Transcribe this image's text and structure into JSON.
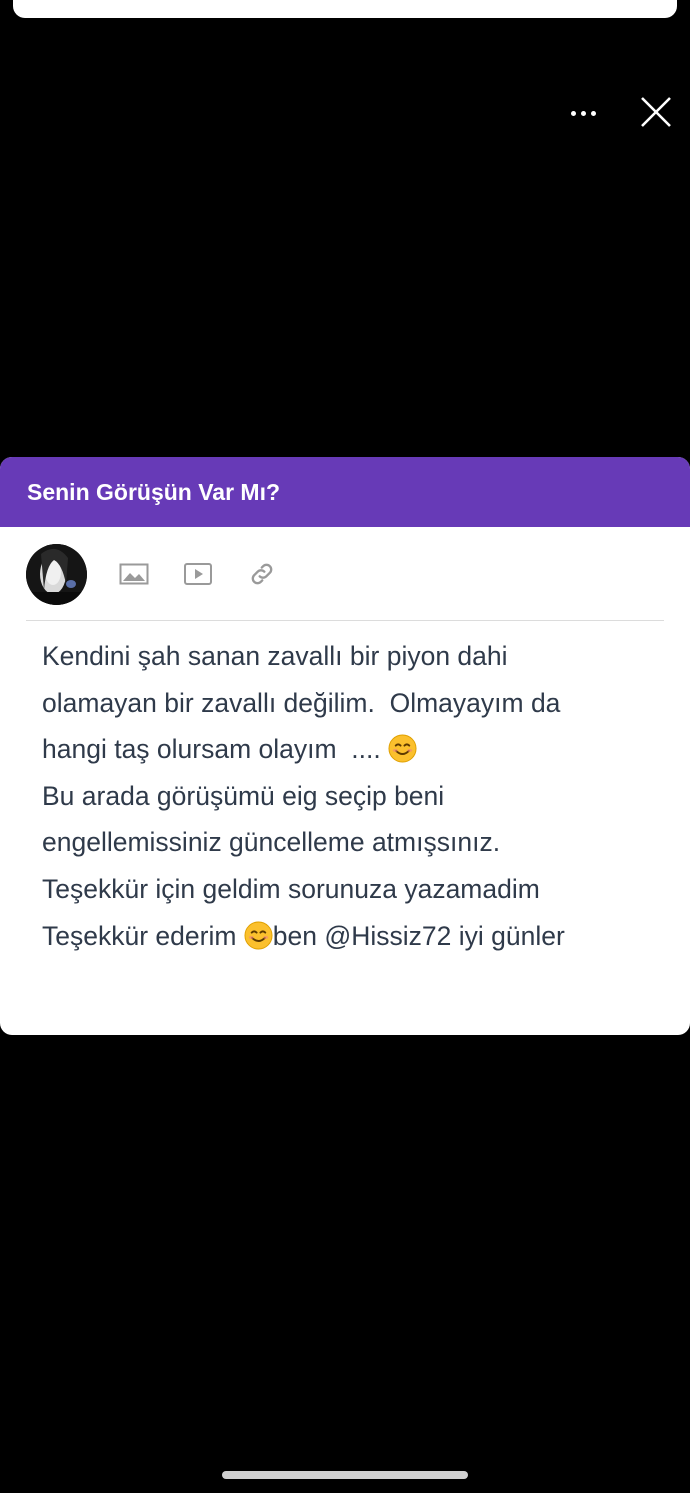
{
  "colors": {
    "header_bg": "#673ab7",
    "text": "#2f3a4a",
    "background": "#000000"
  },
  "top_actions": {
    "more_icon": "more-horizontal-icon",
    "close_icon": "close-icon"
  },
  "card": {
    "title": "Senin Görüşün Var Mı?",
    "toolbar": {
      "avatar": "user-avatar",
      "icons": [
        "image-icon",
        "video-icon",
        "link-icon"
      ]
    },
    "body": {
      "line1": "Kendini şah sanan zavallı bir piyon dahi",
      "line2": "olamayan bir zavallı değilim.  Olmayayım da",
      "line3": "hangi taş olursam olayım  .... ",
      "line4": "Bu arada görüşümü eig seçip beni",
      "line5": "engellemissiniz güncelleme atmışsınız.",
      "line6": "Teşekkür için geldim sorunuza yazamadim",
      "line7a": "Teşekkür ederim ",
      "line7b": "ben @Hissiz72 iyi günler",
      "emoji": "smiling-face-emoji"
    }
  }
}
